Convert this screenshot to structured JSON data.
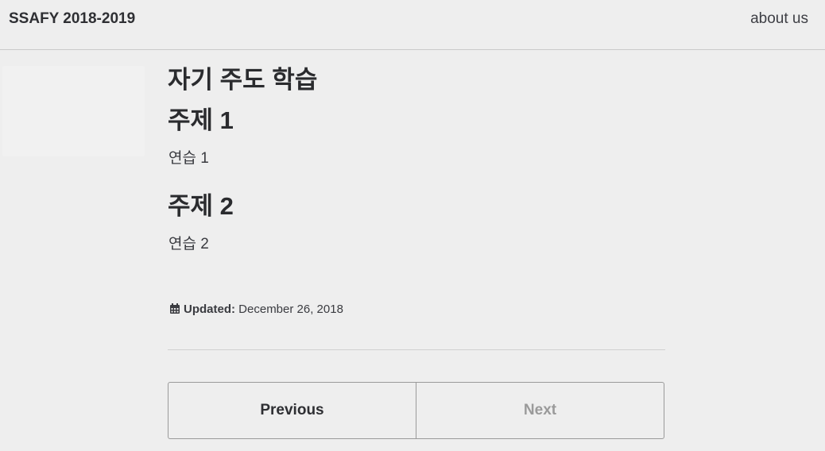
{
  "masthead": {
    "site_title": "SSAFY 2018-2019",
    "nav": [
      {
        "label": "about us"
      }
    ]
  },
  "page": {
    "title": "자기 주도 학습",
    "sections": [
      {
        "heading": "주제 1",
        "text": "연습 1"
      },
      {
        "heading": "주제 2",
        "text": "연습 2"
      }
    ],
    "updated": {
      "icon": "calendar-icon",
      "label": "Updated:",
      "date": "December 26, 2018"
    }
  },
  "pager": {
    "previous_label": "Previous",
    "next_label": "Next",
    "next_disabled": true
  }
}
